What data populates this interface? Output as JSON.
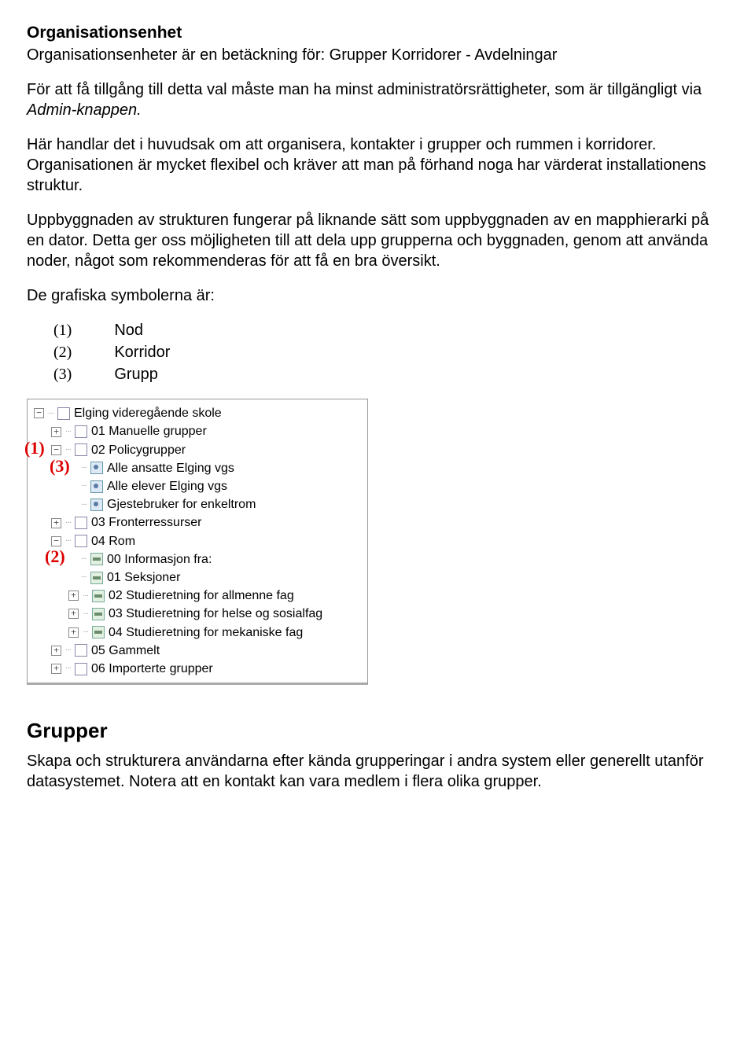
{
  "heading": "Organisationsenhet",
  "subtitle": "Organisationsenheter är en betäckning för: Grupper Korridorer - Avdelningar",
  "para1a": "För att få tillgång till detta val måste man ha minst administratörsrättigheter, som är tillgängligt via ",
  "para1b": "Admin-knappen.",
  "para2": "Här handlar det i huvudsak om att organisera, kontakter i grupper och rummen i korridorer. Organisationen är mycket flexibel och kräver att man på förhand noga har värderat installationens struktur.",
  "para3": "Uppbyggnaden av strukturen fungerar på liknande sätt som uppbyggnaden av en mapphierarki på en dator. Detta ger oss möjligheten till att dela upp grupperna och byggnaden, genom att använda noder, något som rekommenderas för att få en bra översikt.",
  "para4": "De grafiska symbolerna är:",
  "legend": [
    {
      "num": "(1)",
      "label": "Nod"
    },
    {
      "num": "(2)",
      "label": "Korridor"
    },
    {
      "num": "(3)",
      "label": "Grupp"
    }
  ],
  "tree": {
    "root": "Elging videregående skole",
    "n1": "01 Manuelle grupper",
    "n2": "02 Policygrupper",
    "g1": "Alle ansatte Elging vgs",
    "g2": "Alle elever Elging vgs",
    "g3": "Gjestebruker for enkeltrom",
    "n3": "03 Fronterressurser",
    "n4": "04 Rom",
    "c1": "00 Informasjon fra:",
    "c2": "01 Seksjoner",
    "c3": "02 Studieretning for allmenne fag",
    "c4": "03 Studieretning for helse og sosialfag",
    "c5": "04 Studieretning for mekaniske fag",
    "n5": "05 Gammelt",
    "n6": "06 Importerte grupper"
  },
  "ann1": "(1)",
  "ann2": "(2)",
  "ann3": "(3)",
  "section2": "Grupper",
  "para5": "Skapa och strukturera användarna efter kända grupperingar i andra system eller generellt utanför datasystemet. Notera att en kontakt kan vara medlem i flera olika grupper."
}
